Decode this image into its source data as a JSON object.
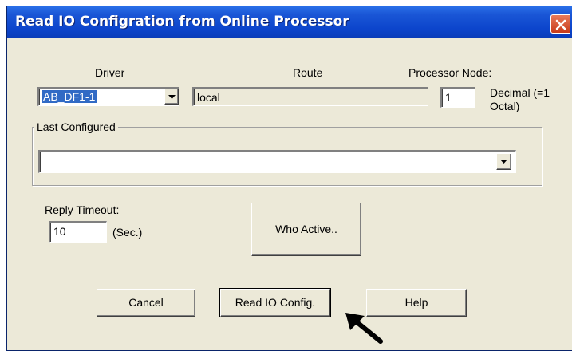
{
  "window": {
    "title": "Read IO Configration from Online Processor"
  },
  "driver": {
    "label": "Driver",
    "value": "AB_DF1-1"
  },
  "route": {
    "label": "Route",
    "value": "local"
  },
  "processor_node": {
    "label": "Processor Node:",
    "value": "1",
    "format_line1": "Decimal (=1",
    "format_line2": "Octal)"
  },
  "last_configured": {
    "label": "Last Configured",
    "value": ""
  },
  "reply_timeout": {
    "label": "Reply Timeout:",
    "value": "10",
    "unit": "(Sec.)"
  },
  "buttons": {
    "who_active": "Who Active..",
    "cancel": "Cancel",
    "read_io_config": "Read IO Config.",
    "help": "Help"
  },
  "icons": {
    "close": "close-icon",
    "dropdown": "chevron-down-icon",
    "pointer": "arrow-pointer-icon"
  }
}
